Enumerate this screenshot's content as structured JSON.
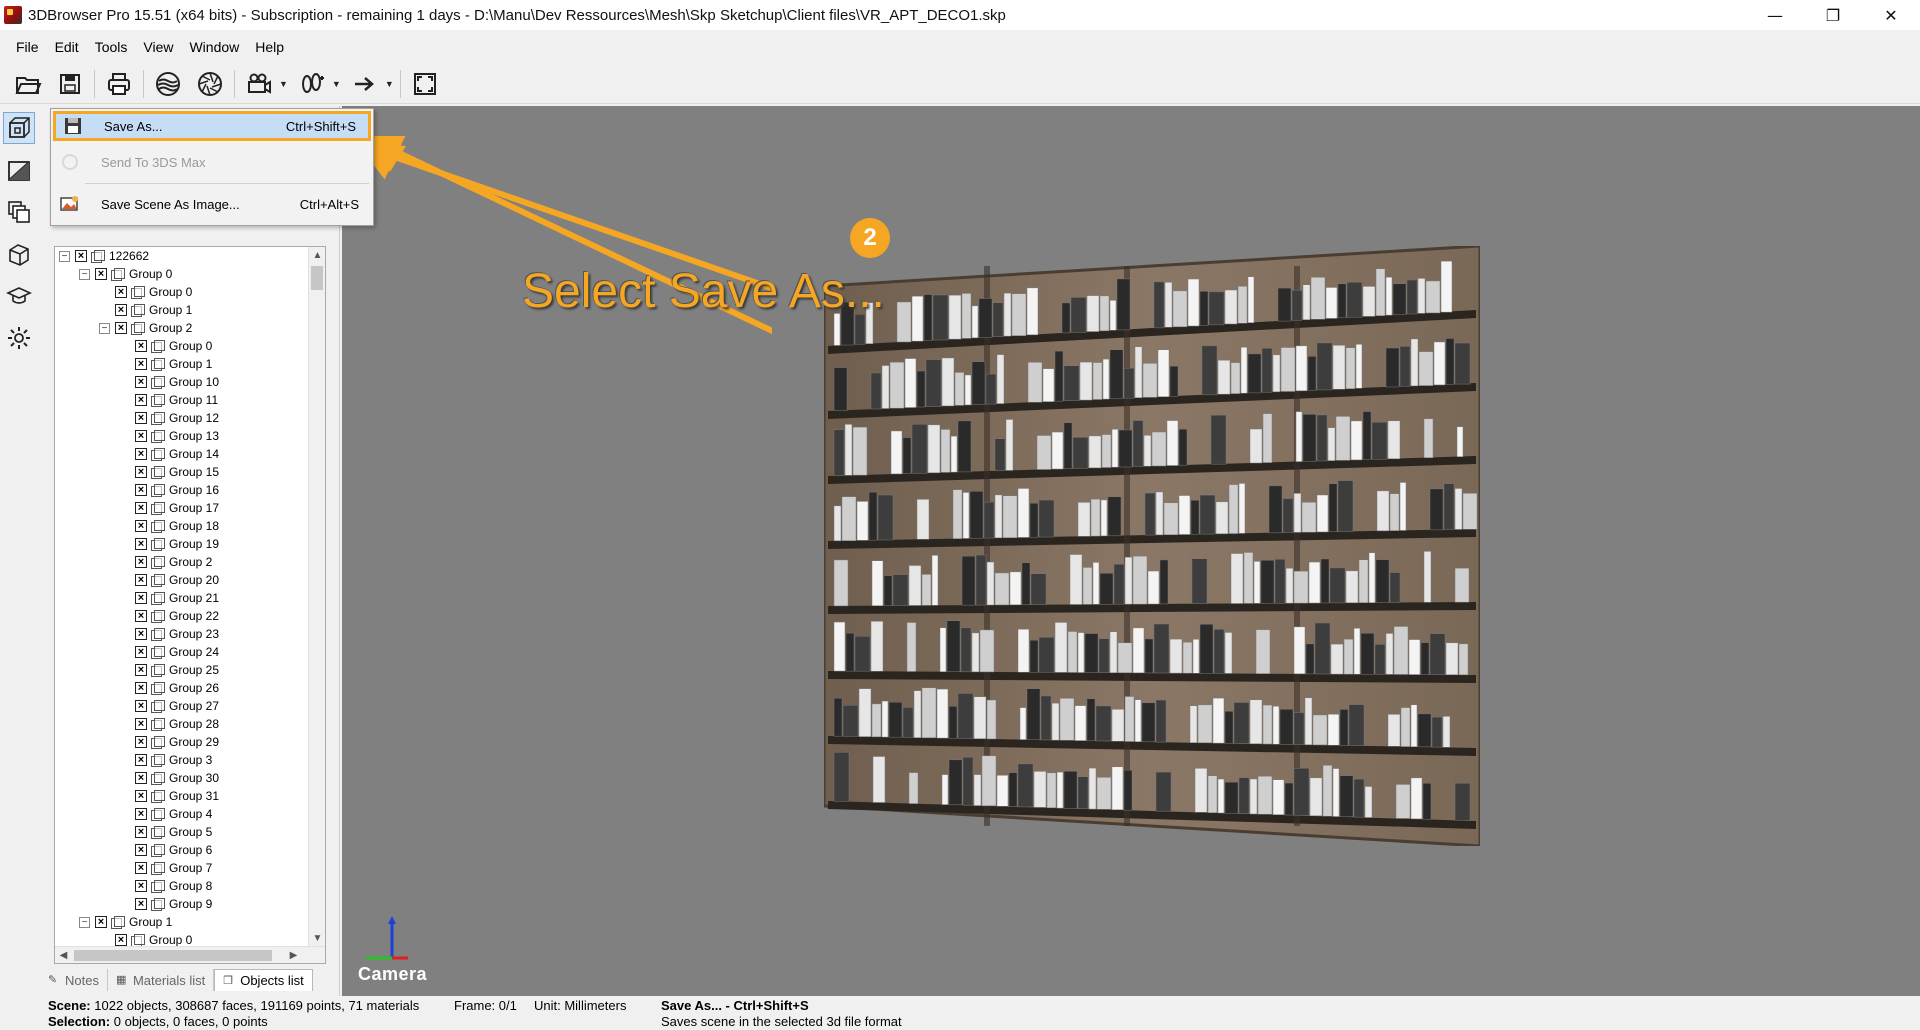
{
  "titlebar": {
    "title": "3DBrowser Pro 15.51 (x64 bits) - Subscription - remaining 1 days - D:\\Manu\\Dev Ressources\\Mesh\\Skp Sketchup\\Client files\\VR_APT_DECO1.skp",
    "minimize": "—",
    "restore": "❐",
    "close": "✕"
  },
  "menu": [
    "File",
    "Edit",
    "Tools",
    "View",
    "Window",
    "Help"
  ],
  "toolbar": {
    "icons": [
      "open-folder-icon",
      "save-icon",
      "print-icon",
      "materials-icon",
      "camera-aperture-icon",
      "video-camera-icon",
      "walk-icon",
      "arrow-right-icon",
      "fullscreen-icon"
    ]
  },
  "dropdown": {
    "items": [
      {
        "label": "Save As...",
        "shortcut": "Ctrl+Shift+S",
        "highlighted": true,
        "enabled": true
      },
      {
        "label": "Send To 3DS Max",
        "shortcut": "",
        "highlighted": false,
        "enabled": false
      },
      {
        "label": "Save Scene As Image...",
        "shortcut": "Ctrl+Alt+S",
        "highlighted": false,
        "enabled": true
      }
    ]
  },
  "callout": {
    "step": "2",
    "text": "Select Save As...",
    "color": "#f5a623"
  },
  "tree": {
    "root": "122662",
    "group0": "Group 0",
    "group0_children_top": [
      "Group 0",
      "Group 1",
      "Group 2"
    ],
    "group2_children": [
      "Group 0",
      "Group 1",
      "Group 10",
      "Group 11",
      "Group 12",
      "Group 13",
      "Group 14",
      "Group 15",
      "Group 16",
      "Group 17",
      "Group 18",
      "Group 19",
      "Group 2",
      "Group 20",
      "Group 21",
      "Group 22",
      "Group 23",
      "Group 24",
      "Group 25",
      "Group 26",
      "Group 27",
      "Group 28",
      "Group 29",
      "Group 3",
      "Group 30",
      "Group 31",
      "Group 4",
      "Group 5",
      "Group 6",
      "Group 7",
      "Group 8",
      "Group 9"
    ],
    "group1": "Group 1",
    "group1_first_child": "Group 0"
  },
  "tabs": [
    {
      "label": "Notes",
      "active": false
    },
    {
      "label": "Materials list",
      "active": false
    },
    {
      "label": "Objects list",
      "active": true
    }
  ],
  "viewport": {
    "camera_label": "Camera",
    "background": "#808080"
  },
  "status": {
    "scene_label": "Scene:",
    "scene_value": "1022 objects, 308687 faces, 191169 points, 71 materials",
    "frame": "Frame: 0/1",
    "unit": "Unit: Millimeters",
    "selection_label": "Selection:",
    "selection_value": "0 objects, 0 faces, 0 points",
    "hint_title": "Save As... - Ctrl+Shift+S",
    "hint_desc": "Saves scene in the selected 3d file format"
  }
}
